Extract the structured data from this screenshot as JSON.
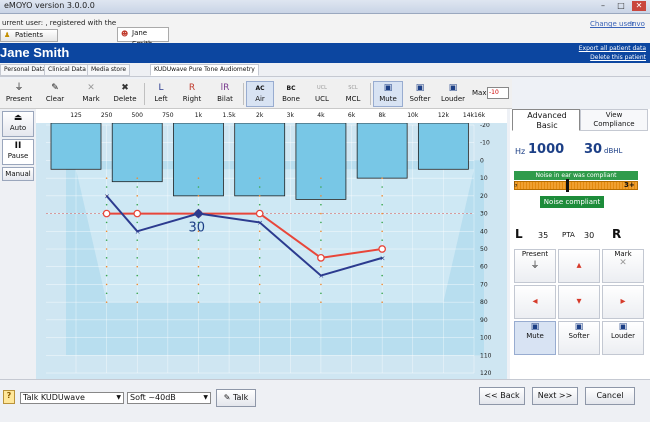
{
  "window": {
    "title": "eMOYO version 3.0.0.0"
  },
  "infobar": {
    "user_line": "urrent user: , registered with the",
    "link_change_user": "Change user",
    "link_more": "Invo",
    "tab_patients": "Patients",
    "tab_patient": "Jane Smith"
  },
  "patient": {
    "name": "Jane Smith",
    "export_link": "Export all patient data",
    "delete_link": "Delete this patient"
  },
  "page_tabs": [
    "Personal Data",
    "Clinical Data",
    "Media store"
  ],
  "page_title": "KUDUwave Pure Tone Audiometry",
  "toolbar": {
    "present": "Present",
    "clear": "Clear",
    "mark": "Mark",
    "delete": "Delete",
    "left_top": "L",
    "left": "Left",
    "right_top": "R",
    "right": "Right",
    "bilat_top": "lR",
    "bilat": "Bilat",
    "air_top": "AC",
    "air": "Air",
    "bone_top": "BC",
    "bone": "Bone",
    "ucl_top": "UCL",
    "ucl": "UCL",
    "mcl_top": "SCL",
    "mcl": "MCL",
    "mute": "Mute",
    "softer": "Softer",
    "louder": "Louder",
    "max_label": "Max",
    "max_value": "-10"
  },
  "left_panel": {
    "auto": "Auto",
    "pause": "Pause",
    "manual": "Manual"
  },
  "chart_data": {
    "type": "line",
    "x_tick_labels": [
      "125",
      "250",
      "500",
      "750",
      "1k",
      "1.5k",
      "2k",
      "3k",
      "4k",
      "6k",
      "8k",
      "10k",
      "12k",
      "14k16k"
    ],
    "x_ticks_hz": [
      125,
      250,
      500,
      750,
      1000,
      1500,
      2000,
      3000,
      4000,
      6000,
      8000,
      10000,
      12000,
      14000
    ],
    "y_ticks": [
      -20,
      -10,
      0,
      10,
      20,
      30,
      40,
      50,
      60,
      70,
      80,
      90,
      100,
      110,
      120
    ],
    "ylim": [
      -20,
      120
    ],
    "y_reversed": true,
    "series": [
      {
        "color": "#e8463a",
        "x": [
          250,
          500,
          1000,
          2000,
          4000,
          8000
        ],
        "y": [
          30,
          30,
          30,
          30,
          55,
          50
        ]
      },
      {
        "color": "#2c3b8f",
        "x": [
          250,
          500,
          1000,
          2000,
          4000,
          8000
        ],
        "y": [
          20,
          40,
          30,
          35,
          65,
          55
        ]
      }
    ],
    "current": {
      "hz": 1000,
      "db": 30,
      "label": "30"
    },
    "noise_bars_db": [
      5,
      8,
      12,
      22,
      20,
      20,
      20,
      22,
      22,
      10,
      10,
      5,
      5,
      5
    ],
    "grid": true
  },
  "right_panel": {
    "tab_advanced": "Advanced",
    "tab_basic": "Basic",
    "tab_view": "View",
    "tab_compliance": "Compliance",
    "hz_label": "Hz",
    "hz_value": "1000",
    "db_value": "30",
    "db_unit": "dBHL",
    "noise_msg": "Noise in ear was compliant",
    "noise_level": "3+",
    "noise_compliant": "Noise compliant",
    "pta_l_letter": "L",
    "pta_l_value": "35",
    "pta_label": "PTA",
    "pta_r_value": "30",
    "pta_r_letter": "R",
    "present": "Present",
    "mark": "Mark",
    "mute": "Mute",
    "softer": "Softer",
    "louder": "Louder"
  },
  "bottom": {
    "talk_select": "Talk KUDUwave",
    "level_select": "Soft ~40dB",
    "talk_button": "Talk",
    "back": "<< Back",
    "next": "Next >>",
    "cancel": "Cancel",
    "help": "?"
  },
  "colors": {
    "accent": "#0c46a0",
    "chart_bg": "#cfe6f2",
    "inner": "#a9d8ec",
    "right_ear": "#e8463a",
    "left_ear": "#2c3b8f",
    "compliant": "#1d8c3a"
  }
}
